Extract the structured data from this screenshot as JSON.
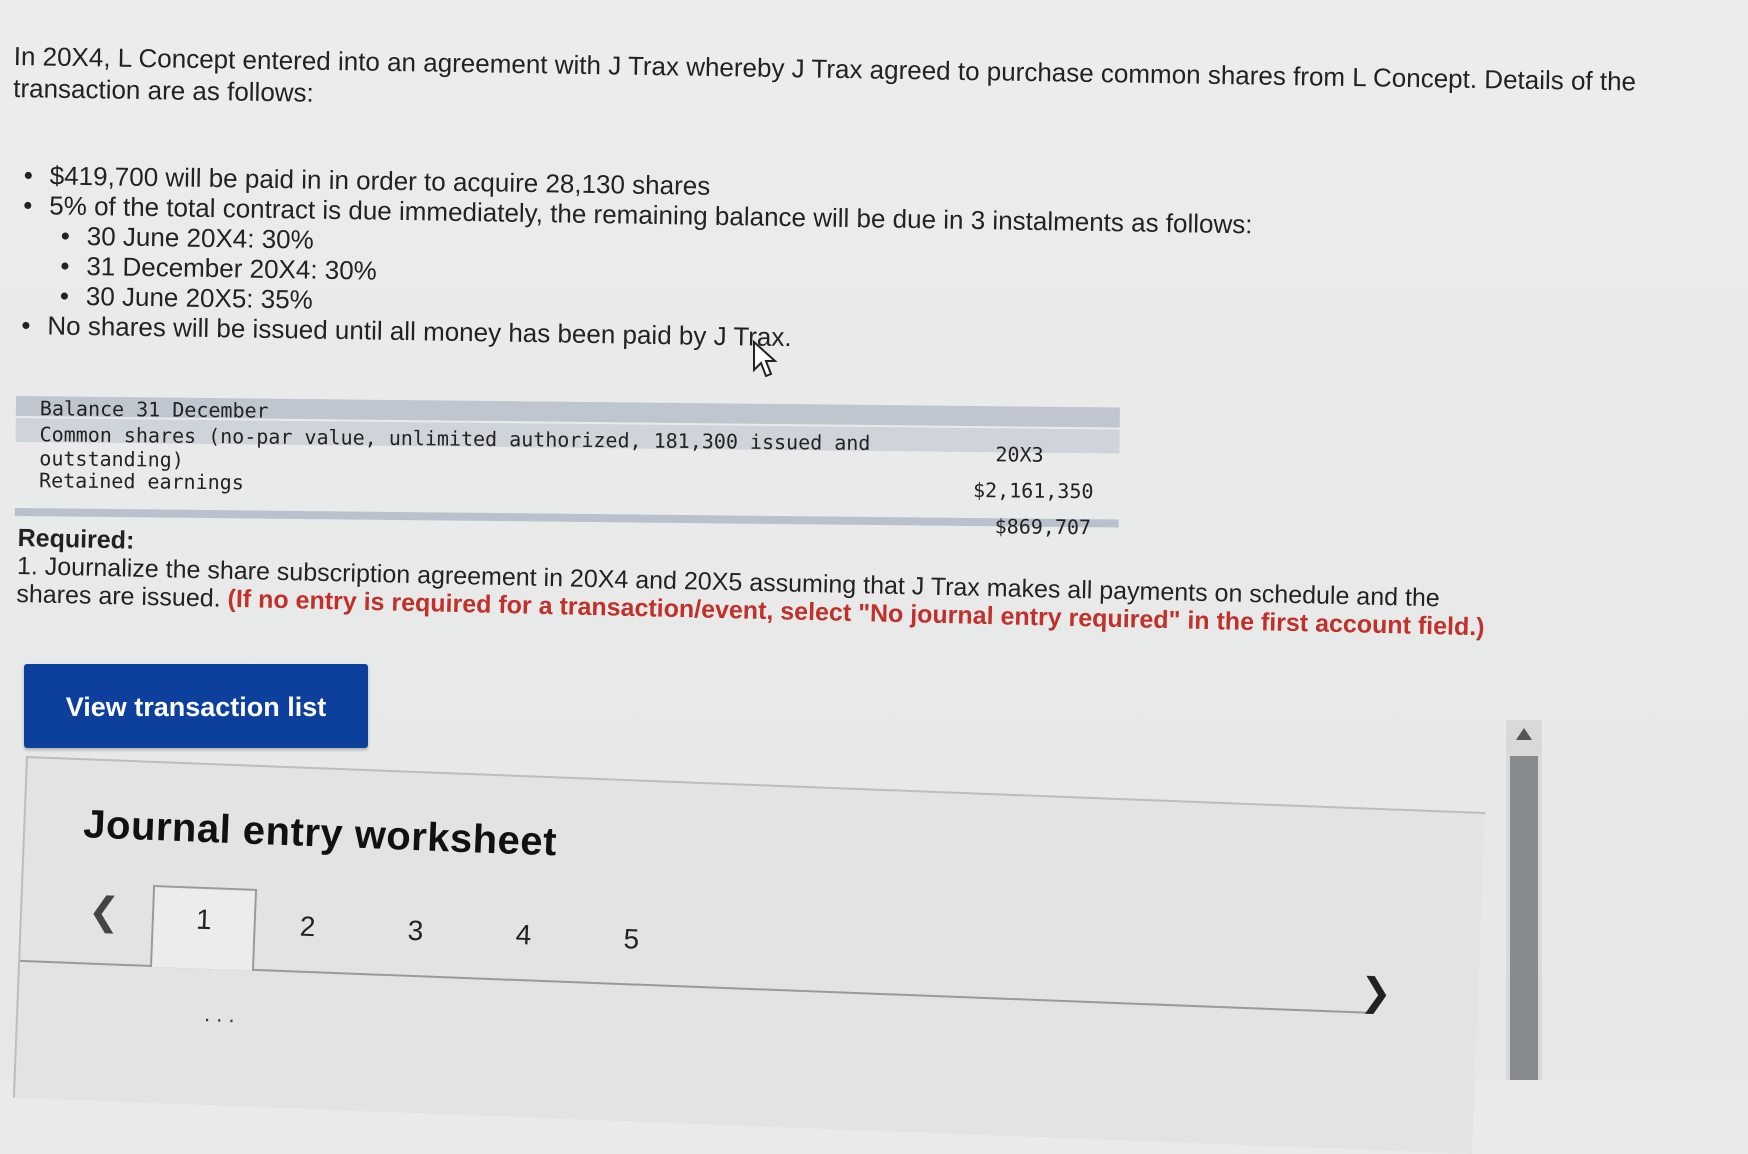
{
  "intro": "In 20X4, L Concept entered into an agreement with J Trax whereby J Trax agreed to purchase common shares from L Concept. Details of the transaction are as follows:",
  "bullets": {
    "b1": "$419,700 will be paid in in order to acquire 28,130 shares",
    "b2": "5% of the total contract is due immediately, the remaining balance will be due in 3 instalments as follows:",
    "sub": [
      "30 June 20X4: 30%",
      "31 December 20X4: 30%",
      "30 June 20X5: 35%"
    ],
    "b3": "No shares will be issued until all money has been paid by J Trax."
  },
  "balance": {
    "heading": "Balance 31 December",
    "year": "20X3",
    "common_label": "Common shares (no-par value, unlimited authorized, 181,300 issued and outstanding)",
    "common_value": "$2,161,350",
    "retained_label": "Retained earnings",
    "retained_value": "$869,707"
  },
  "required": {
    "title": "Required:",
    "text": "1. Journalize the share subscription agreement in 20X4 and 20X5 assuming that J Trax makes all payments on schedule and the shares are issued.",
    "note": "(If no entry is required for a transaction/event, select \"No journal entry required\" in the first account field.)"
  },
  "button": {
    "view_transactions": "View transaction list"
  },
  "worksheet": {
    "title": "Journal entry worksheet",
    "tabs": [
      "1",
      "2",
      "3",
      "4",
      "5"
    ]
  },
  "icons": {
    "prev": "chevron-left-icon",
    "next": "chevron-right-icon",
    "scroll_up": "scroll-up-icon",
    "cursor": "mouse-cursor-icon"
  },
  "colors": {
    "button_bg": "#0d3f9c",
    "note_red": "#c0312b",
    "table_band": "#bfc6cf"
  }
}
